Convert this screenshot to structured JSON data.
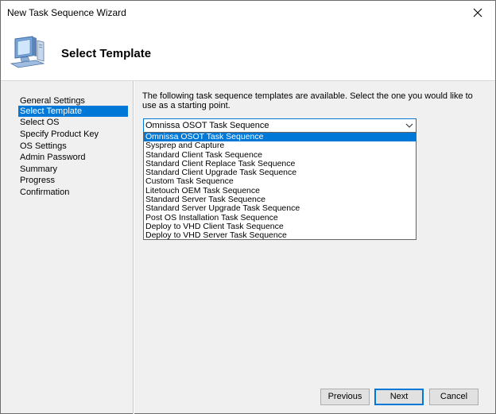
{
  "window": {
    "title": "New Task Sequence Wizard"
  },
  "header": {
    "title": "Select Template",
    "icon": "computer-icon"
  },
  "nav": {
    "items": [
      {
        "label": "General Settings",
        "selected": false
      },
      {
        "label": "Select Template",
        "selected": true
      },
      {
        "label": "Select OS",
        "selected": false
      },
      {
        "label": "Specify Product Key",
        "selected": false
      },
      {
        "label": "OS Settings",
        "selected": false
      },
      {
        "label": "Admin Password",
        "selected": false
      },
      {
        "label": "Summary",
        "selected": false
      },
      {
        "label": "Progress",
        "selected": false
      },
      {
        "label": "Confirmation",
        "selected": false
      }
    ]
  },
  "content": {
    "instructions": "The following task sequence templates are available.  Select the one you would like to use as a starting point.",
    "combo_value": "Omnissa OSOT Task Sequence",
    "options": [
      {
        "label": "Omnissa OSOT Task Sequence",
        "selected": true
      },
      {
        "label": "Sysprep and Capture",
        "selected": false
      },
      {
        "label": "Standard Client Task Sequence",
        "selected": false
      },
      {
        "label": "Standard Client Replace Task Sequence",
        "selected": false
      },
      {
        "label": "Standard Client Upgrade Task Sequence",
        "selected": false
      },
      {
        "label": "Custom Task Sequence",
        "selected": false
      },
      {
        "label": "Litetouch OEM Task Sequence",
        "selected": false
      },
      {
        "label": "Standard Server Task Sequence",
        "selected": false
      },
      {
        "label": "Standard Server Upgrade Task Sequence",
        "selected": false
      },
      {
        "label": "Post OS Installation Task Sequence",
        "selected": false
      },
      {
        "label": "Deploy to VHD Client Task Sequence",
        "selected": false
      },
      {
        "label": "Deploy to VHD Server Task Sequence",
        "selected": false
      }
    ]
  },
  "buttons": {
    "previous": "Previous",
    "next": "Next",
    "cancel": "Cancel"
  },
  "colors": {
    "accent": "#0078d7",
    "panel": "#f0f0f0"
  }
}
